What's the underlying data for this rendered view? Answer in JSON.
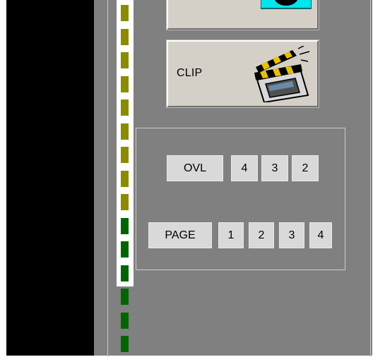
{
  "clip_button": {
    "label": "CLIP",
    "icon": "clapperboard-icon"
  },
  "top_button": {
    "icon": "camera-icon"
  },
  "overlay_row": {
    "label": "OVL",
    "numbers": [
      "4",
      "3",
      "2"
    ]
  },
  "page_row": {
    "label": "PAGE",
    "numbers": [
      "1",
      "2",
      "3",
      "4"
    ]
  },
  "level_meter": {
    "segment_colors": [
      "#8b8b00",
      "#006400"
    ],
    "olive_segments": 9,
    "green_segments": 6
  },
  "colors": {
    "panel_gray": "#808080",
    "button_face": "#d9d9d9",
    "meter_olive": "#8b8b00",
    "meter_green": "#006400",
    "icon_cyan": "#00e5ee"
  }
}
